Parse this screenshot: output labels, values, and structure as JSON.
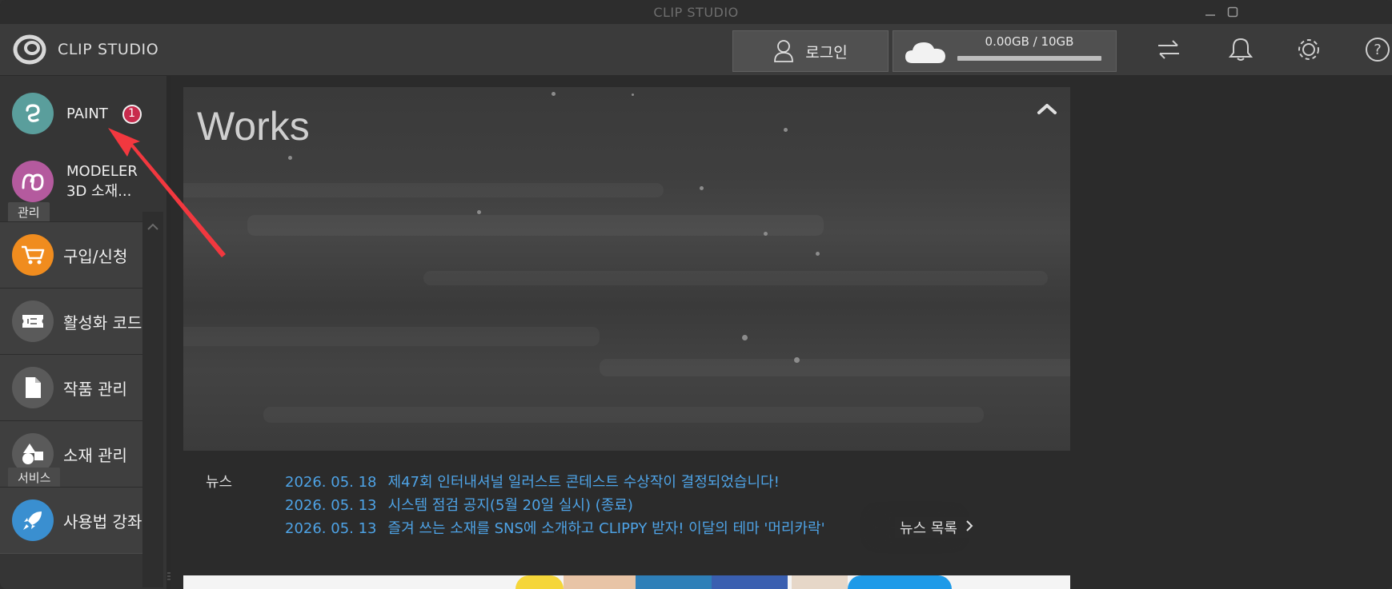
{
  "window": {
    "title": "CLIP STUDIO"
  },
  "header": {
    "logo_text": "CLIP STUDIO",
    "login_label": "로그인",
    "storage_text": "0.00GB / 10GB",
    "storage_used_fraction": 0.0
  },
  "sidebar": {
    "apps": [
      {
        "label": "PAINT",
        "badge": "1",
        "icon": "paint-icon",
        "color": "#5a9e9c"
      },
      {
        "label_line1": "MODELER",
        "label_line2": "3D 소재...",
        "icon": "modeler-icon",
        "color": "#b45a9e"
      }
    ],
    "section_manage": "관리",
    "manage_items": [
      {
        "label": "구입/신청",
        "icon": "cart-icon",
        "color": "#f08c1e"
      },
      {
        "label": "활성화 코드",
        "icon": "ticket-icon",
        "color": "#5a5a5a"
      },
      {
        "label": "작품 관리",
        "icon": "document-icon",
        "color": "#5a5a5a"
      },
      {
        "label": "소재 관리",
        "icon": "shapes-icon",
        "color": "#5a5a5a"
      }
    ],
    "section_service": "서비스",
    "service_items": [
      {
        "label": "사용법 강좌",
        "icon": "rocket-icon",
        "color": "#3a8fd0"
      }
    ]
  },
  "banner": {
    "title": "Works"
  },
  "news": {
    "heading": "뉴스",
    "items": [
      {
        "date": "2026. 05. 18",
        "text": "제47회 인터내셔널 일러스트 콘테스트 수상작이 결정되었습니다!"
      },
      {
        "date": "2026. 05. 13",
        "text": "시스템 점검 공지(5월 20일 실시) (종료)"
      },
      {
        "date": "2026. 05. 13",
        "text": "즐겨 쓰는 소재를 SNS에 소개하고 CLIPPY 받자! 이달의 테마 '머리카락'"
      }
    ],
    "more_label": "뉴스 목록"
  },
  "colors": {
    "accent_link": "#4ea3e6",
    "badge": "#c82b4d",
    "annotation_arrow": "#f2383f"
  }
}
